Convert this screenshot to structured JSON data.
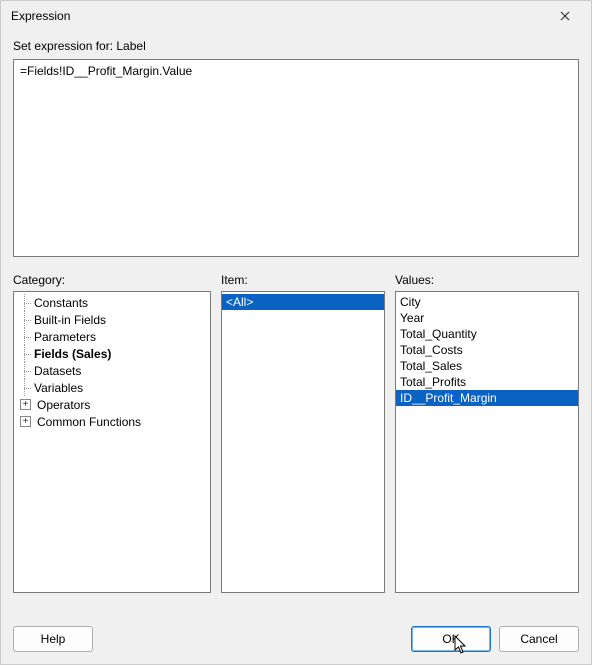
{
  "window": {
    "title": "Expression"
  },
  "header": {
    "set_for_label": "Set expression for: Label"
  },
  "expression": {
    "value": "=Fields!ID__Profit_Margin.Value"
  },
  "panels": {
    "category_label": "Category:",
    "item_label": "Item:",
    "values_label": "Values:"
  },
  "category_tree": {
    "items": [
      {
        "label": "Constants",
        "expandable": false,
        "selected": false
      },
      {
        "label": "Built-in Fields",
        "expandable": false,
        "selected": false
      },
      {
        "label": "Parameters",
        "expandable": false,
        "selected": false
      },
      {
        "label": "Fields (Sales)",
        "expandable": false,
        "selected": true
      },
      {
        "label": "Datasets",
        "expandable": false,
        "selected": false
      },
      {
        "label": "Variables",
        "expandable": false,
        "selected": false
      },
      {
        "label": "Operators",
        "expandable": true,
        "expanded": false,
        "selected": false
      },
      {
        "label": "Common Functions",
        "expandable": true,
        "expanded": false,
        "selected": false
      }
    ]
  },
  "item_list": {
    "items": [
      {
        "label": "<All>",
        "selected": true
      }
    ]
  },
  "values_list": {
    "items": [
      {
        "label": "City",
        "selected": false
      },
      {
        "label": "Year",
        "selected": false
      },
      {
        "label": "Total_Quantity",
        "selected": false
      },
      {
        "label": "Total_Costs",
        "selected": false
      },
      {
        "label": "Total_Sales",
        "selected": false
      },
      {
        "label": "Total_Profits",
        "selected": false
      },
      {
        "label": "ID__Profit_Margin",
        "selected": true
      }
    ]
  },
  "buttons": {
    "help": "Help",
    "ok": "OK",
    "cancel": "Cancel"
  }
}
